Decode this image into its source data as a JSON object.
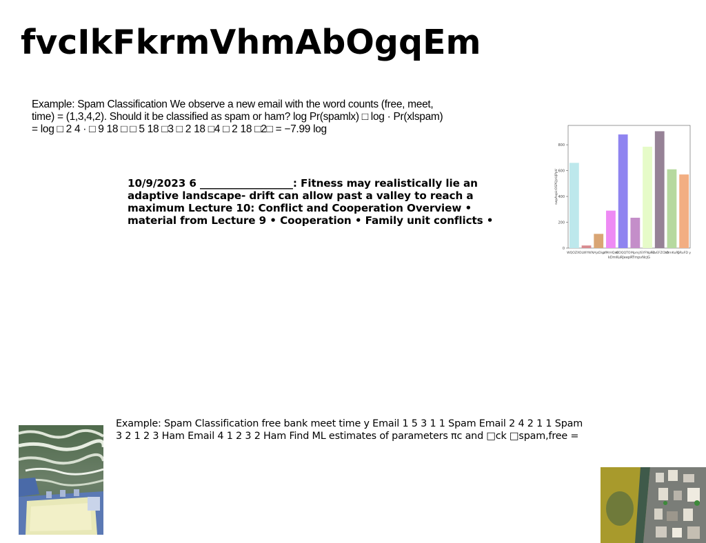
{
  "title": "fvcIkFkrmVhmAbOgqEm",
  "paragraph_1": "Example: Spam Classification We observe a new email with the word counts (free, meet, time) = (1,3,4,2). Should it be classified as spam or ham? log Pr(spamlx) □ log · Pr(xlspam) = log □ 2 4 · □ 9 18 □ □ 5 18 □3 □ 2 18 □4 □ 2 18 □2□ = −7.99 log",
  "paragraph_2": "10/9/2023 6 __________________: Fitness may realistically lie an adaptive landscape- drift can allow past a valley to reach a maximum Lecture 10: Conflict and Cooperation Overview • material from Lecture 9 • Cooperation • Family unit conflicts •",
  "paragraph_3": "Example: Spam Classification free bank meet time y Email 1 5 3 1 1 Spam Email 2 4 2 1 1 Spam 3 2 1 2 3 Ham Email 4 1 2 3 2 Ham Find ML estimates of parameters πc and □ck □spam,free =",
  "chart_data": {
    "type": "bar",
    "categories": [
      "WQOZXO",
      "LWYW",
      "NAjsDigx",
      "cfMrHQxC",
      "WOQQTO",
      "Mpmj",
      "lSYFNpHo",
      "FZvEFZChh",
      "kDmKuRJ",
      "GRuFD y"
    ],
    "values": [
      660,
      20,
      110,
      290,
      880,
      235,
      785,
      905,
      610,
      570
    ],
    "colors": [
      "#bde8ec",
      "#d88a8f",
      "#d9a574",
      "#ee8af4",
      "#8f84f0",
      "#c48ec9",
      "#e6fbc8",
      "#968296",
      "#b6d99f",
      "#f2ae82"
    ],
    "xlabel": "kDmKuRJeepRTmpvNcjG",
    "ylabel": "swpAxpicOSPQJzUjPpV",
    "yticks": [
      0,
      200,
      400,
      600,
      800
    ],
    "ylim": [
      0,
      950
    ]
  },
  "images": {
    "left": "waves-and-rooftop-photo",
    "right": "aerial-coastline-photo"
  }
}
